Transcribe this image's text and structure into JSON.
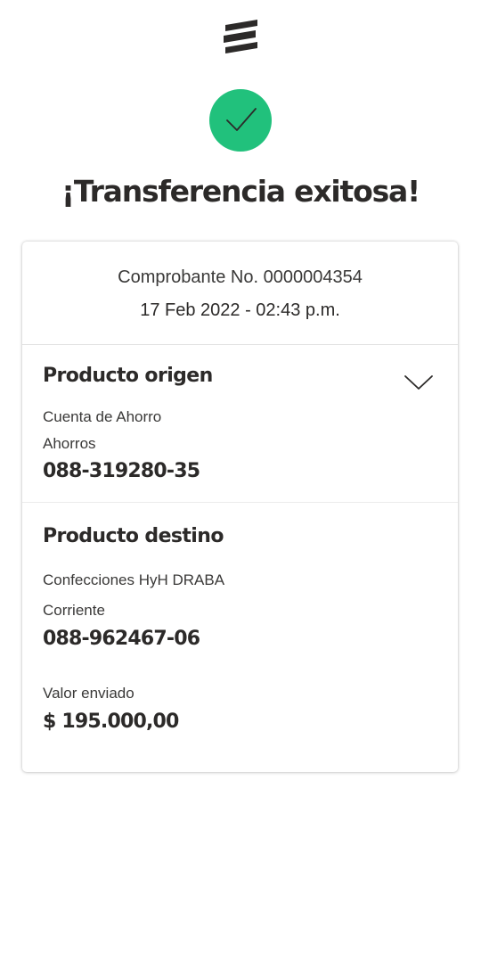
{
  "header": {
    "logo_icon": "bank-logo-icon",
    "success_icon": "check-icon",
    "success_color": "#21c17c",
    "title": "¡Transferencia exitosa!"
  },
  "receipt": {
    "number_label": "Comprobante No. 0000004354",
    "datetime": "17 Feb 2022 - 02:43 p.m."
  },
  "origin": {
    "title": "Producto origen",
    "product_type": "Cuenta de Ahorro",
    "account_type": "Ahorros",
    "account_number": "088-319280-35",
    "toggle_icon": "chevron-down-icon"
  },
  "destination": {
    "title": "Producto destino",
    "holder": "Confecciones HyH DRABA",
    "account_type": "Corriente",
    "account_number": "088-962467-06",
    "amount_label": "Valor enviado",
    "amount": "$ 195.000,00"
  }
}
